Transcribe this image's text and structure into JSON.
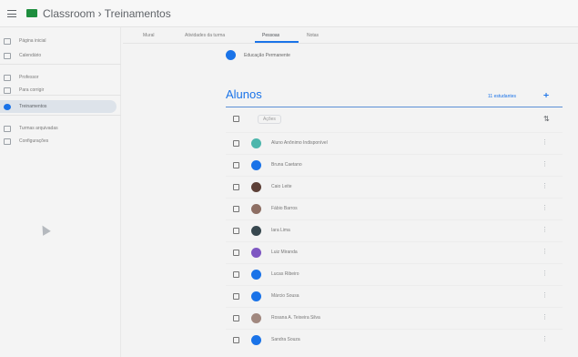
{
  "header": {
    "app_title": "Classroom  ›  Treinamentos"
  },
  "sidebar": {
    "items": [
      {
        "label": "Página inicial",
        "icon": "home-icon"
      },
      {
        "label": "Calendário",
        "icon": "calendar-icon"
      },
      {
        "label": "Professor",
        "icon": "teaching-icon"
      },
      {
        "label": "Para corrigir",
        "icon": "review-icon"
      },
      {
        "label": "Treinamentos",
        "icon": "class-icon",
        "active": true
      },
      {
        "label": "Turmas arquivadas",
        "icon": "archive-icon"
      },
      {
        "label": "Configurações",
        "icon": "settings-icon"
      }
    ]
  },
  "tabs": [
    {
      "label": "Mural"
    },
    {
      "label": "Atividades da turma"
    },
    {
      "label": "Pessoas",
      "active": true
    },
    {
      "label": "Notas"
    }
  ],
  "teacher": {
    "name": "Educação Permanente"
  },
  "students": {
    "title": "Alunos",
    "count_label": "11 estudantes",
    "actions_label": "Ações",
    "list": [
      {
        "name": "Aluno Anônimo Indisponível",
        "avatar_color": "#4db6ac"
      },
      {
        "name": "Bruna Caetano",
        "avatar_color": "#1a73e8"
      },
      {
        "name": "Caio Leite",
        "avatar_color": "#5d4037"
      },
      {
        "name": "Fábio Barros",
        "avatar_color": "#8d6e63"
      },
      {
        "name": "Iara Lima",
        "avatar_color": "#37474f"
      },
      {
        "name": "Luiz Miranda",
        "avatar_color": "#7e57c2"
      },
      {
        "name": "Lucas Ribeiro",
        "avatar_color": "#1a73e8"
      },
      {
        "name": "Márcio Sousa",
        "avatar_color": "#1a73e8"
      },
      {
        "name": "Rosana A. Teixeira Silva",
        "avatar_color": "#a1887f"
      },
      {
        "name": "Sandra Souza",
        "avatar_color": "#1a73e8"
      }
    ]
  }
}
